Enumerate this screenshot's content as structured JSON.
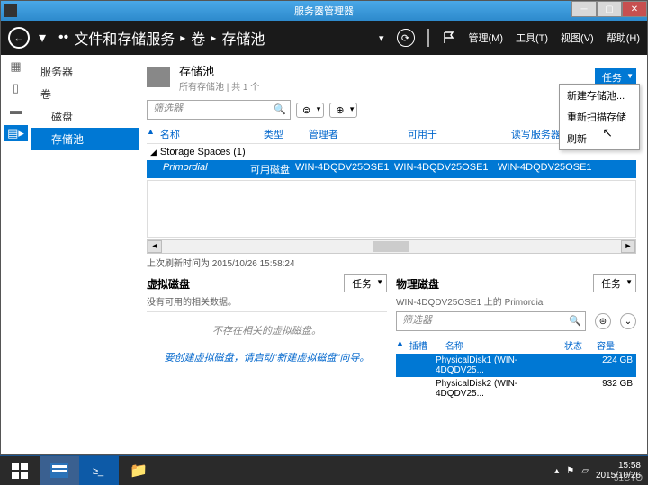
{
  "window": {
    "title": "服务器管理器"
  },
  "navbar": {
    "breadcrumb": [
      "文件和存储服务",
      "卷",
      "存储池"
    ],
    "menus": {
      "manage": "管理(M)",
      "tools": "工具(T)",
      "view": "视图(V)",
      "help": "帮助(H)"
    }
  },
  "sidebar": {
    "items": [
      {
        "label": "服务器"
      },
      {
        "label": "卷"
      },
      {
        "label": "磁盘"
      },
      {
        "label": "存储池",
        "active": true
      }
    ]
  },
  "pool": {
    "title": "存储池",
    "subtitle": "所有存储池 | 共 1 个",
    "tasks": "任务",
    "filter_placeholder": "筛选器",
    "columns": {
      "name": "名称",
      "type": "类型",
      "manager": "管理者",
      "usable": "可用于",
      "rw": "读写服务器"
    },
    "group": "Storage Spaces (1)",
    "row": {
      "name": "Primordial",
      "type": "可用磁盘",
      "manager": "WIN-4DQDV25OSE1",
      "usable": "WIN-4DQDV25OSE1",
      "rw": "WIN-4DQDV25OSE1"
    },
    "refresh_status": "上次刷新时间为 2015/10/26 15:58:24"
  },
  "context_menu": {
    "items": [
      "新建存储池...",
      "重新扫描存储",
      "刷新"
    ]
  },
  "virtual": {
    "title": "虚拟磁盘",
    "subtitle": "没有可用的相关数据。",
    "tasks": "任务",
    "empty1": "不存在相关的虚拟磁盘。",
    "empty2": "要创建虚拟磁盘，请启动\"新建虚拟磁盘\"向导。"
  },
  "physical": {
    "title": "物理磁盘",
    "subtitle": "WIN-4DQDV25OSE1 上的 Primordial",
    "tasks": "任务",
    "filter_placeholder": "筛选器",
    "columns": {
      "slot": "插槽",
      "name": "名称",
      "status": "状态",
      "capacity": "容量"
    },
    "rows": [
      {
        "name": "PhysicalDisk1 (WIN-4DQDV25...",
        "capacity": "224 GB",
        "selected": true
      },
      {
        "name": "PhysicalDisk2 (WIN-4DQDV25...",
        "capacity": "932 GB",
        "selected": false
      }
    ]
  },
  "taskbar": {
    "time": "15:58",
    "date": "2015/10/26"
  },
  "watermark": "51CTO"
}
